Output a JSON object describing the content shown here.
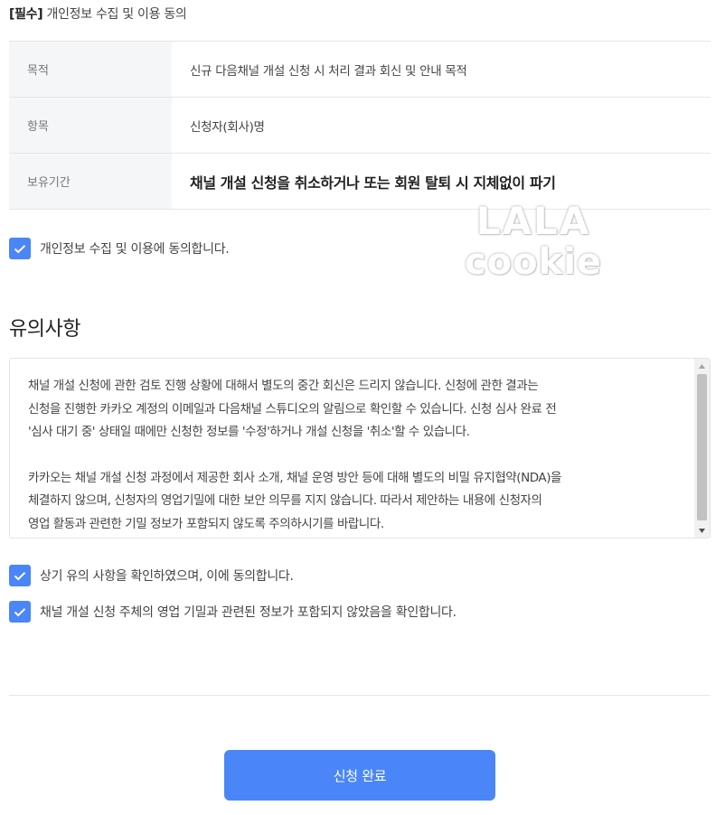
{
  "consent": {
    "required_tag": "[필수]",
    "title": " 개인정보 수집 및 이용 동의",
    "rows": [
      {
        "label": "목적",
        "value": "신규 다음채널 개설 신청 시 처리 결과 회신 및 안내 목적"
      },
      {
        "label": "항목",
        "value": "신청자(회사)명"
      },
      {
        "label": "보유기간",
        "value": "채널 개설 신청을 취소하거나 또는 회원 탈퇴 시 지체없이 파기"
      }
    ],
    "agree_label": "개인정보 수집 및 이용에 동의합니다.",
    "agree_checked": true
  },
  "watermark": {
    "line1": "LALA",
    "line2": "cookie"
  },
  "notice": {
    "title": "유의사항",
    "paragraphs": [
      [
        "채널 개설 신청에 관한 검토 진행 상황에 대해서 별도의 중간 회신은 드리지 않습니다. 신청에 관한 결과는",
        "신청을 진행한 카카오 계정의 이메일과 다음채널 스튜디오의 알림으로 확인할 수 있습니다. 신청 심사 완료 전",
        "'심사 대기 중' 상태일 때에만 신청한 정보를 '수정'하거나 개설 신청을 '취소'할 수 있습니다."
      ],
      [
        "카카오는 채널 개설 신청 과정에서 제공한 회사 소개, 채널 운영 방안 등에 대해 별도의 비밀 유지협약(NDA)을",
        "체결하지 않으며, 신청자의 영업기밀에 대한 보안 의무를 지지 않습니다. 따라서 제안하는 내용에 신청자의",
        "영업 활동과 관련한 기밀 정보가 포함되지 않도록 주의하시기를 바랍니다."
      ]
    ]
  },
  "confirmations": [
    {
      "label": "상기 유의 사항을 확인하였으며, 이에 동의합니다.",
      "checked": true
    },
    {
      "label": "채널 개설 신청 주체의 영업 기밀과 관련된 정보가 포함되지 않았음을 확인합니다.",
      "checked": true
    }
  ],
  "submit_label": "신청 완료",
  "colors": {
    "accent": "#4a86f7",
    "label_bg": "#f5f6f7",
    "border": "#e6e6e6"
  }
}
